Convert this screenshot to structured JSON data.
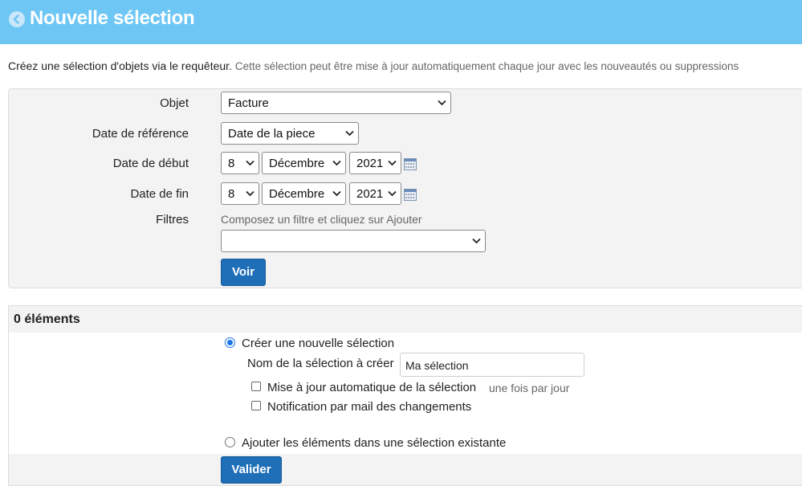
{
  "header": {
    "title": "Nouvelle sélection",
    "back_icon": "chevron-left-circle-icon"
  },
  "intro": {
    "main": "Créez une sélection d'objets via le requêteur.",
    "sub": "Cette sélection peut être mise à jour automatiquement chaque jour avec les nouveautés ou suppressions"
  },
  "form": {
    "objet_label": "Objet",
    "objet_value": "Facture",
    "date_ref_label": "Date de référence",
    "date_ref_value": "Date de la piece",
    "date_debut_label": "Date de début",
    "date_debut": {
      "day": "8",
      "month": "Décembre",
      "year": "2021"
    },
    "date_fin_label": "Date de fin",
    "date_fin": {
      "day": "8",
      "month": "Décembre",
      "year": "2021"
    },
    "filtres_label": "Filtres",
    "filtres_hint": "Composez un filtre et cliquez sur Ajouter",
    "filtres_value": "",
    "voir_label": "Voir"
  },
  "results": {
    "title": "0 éléments",
    "create_new_label": "Créer une nouvelle sélection",
    "create_new_selected": true,
    "name_label": "Nom de la sélection à créer",
    "name_value": "Ma sélection",
    "auto_update_label": "Mise à jour automatique de la sélection",
    "auto_update_hint": "une fois par jour",
    "auto_update_checked": false,
    "notify_label": "Notification par mail des changements",
    "notify_checked": false,
    "add_existing_label": "Ajouter les éléments dans une sélection existante",
    "add_existing_selected": false,
    "valider_label": "Valider"
  },
  "colors": {
    "header_bg": "#6ec6f5",
    "button_bg": "#1f6fb8",
    "radio_accent": "#1a73e8"
  }
}
